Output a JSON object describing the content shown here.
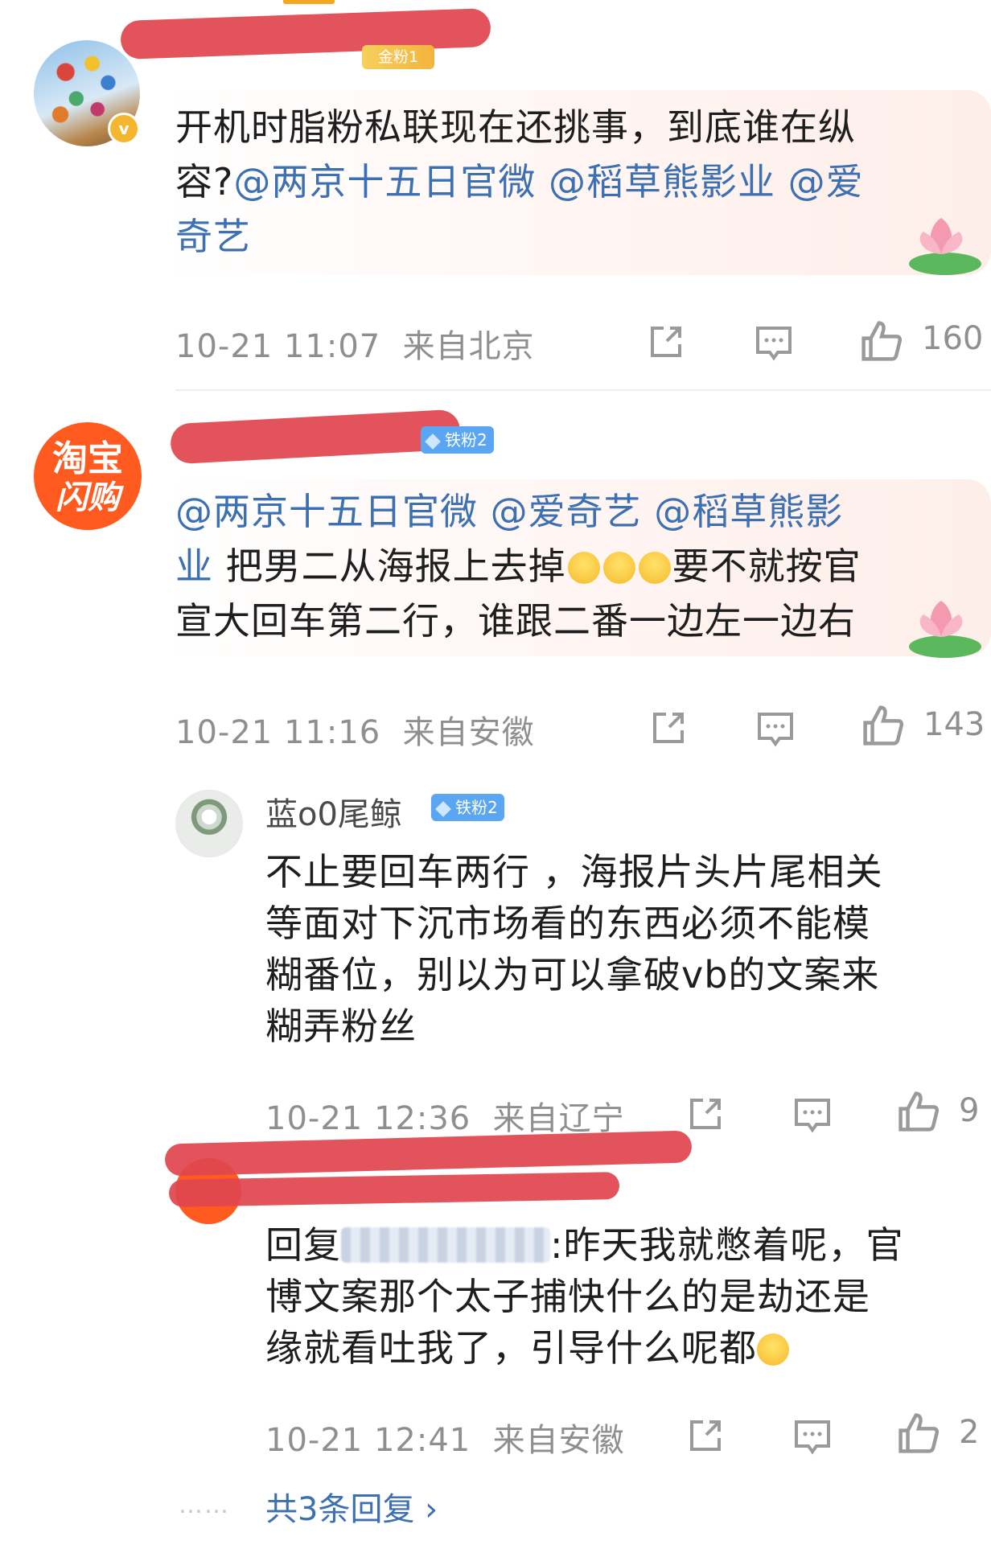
{
  "comments": [
    {
      "badge": "金粉1",
      "text_plain_1": "开机时脂粉私联现在还挑事，到底谁在纵",
      "text_plain_2": "容?",
      "mentions": [
        "@两京十五日官微",
        "@稻草熊影业",
        "@爱",
        "奇艺"
      ],
      "time": "10-21 11:07",
      "location": "来自北京",
      "likes": "160"
    },
    {
      "avatar_line1": "淘宝",
      "avatar_line2": "闪购",
      "badge": "铁粉2",
      "mentions": [
        "@两京十五日官微",
        "@爱奇艺",
        "@稻草熊影",
        "业"
      ],
      "text_1": "把男二从海报上去掉",
      "text_2": "要不就按官",
      "text_3": "宣大回车第二行，谁跟二番一边左一边右",
      "time": "10-21 11:16",
      "location": "来自安徽",
      "likes": "143"
    }
  ],
  "replies": [
    {
      "username": "蓝o0尾鲸",
      "badge": "铁粉2",
      "lines": [
        "不止要回车两行 ，海报片头片尾相关",
        "等面对下沉市场看的东西必须不能模",
        "糊番位，别以为可以拿破vb的文案来",
        "糊弄粉丝"
      ],
      "time": "10-21 12:36",
      "location": "来自辽宁",
      "likes": "9"
    },
    {
      "reply_prefix": "回复",
      "reply_tail": ":昨天我就憋着呢，官",
      "lines": [
        "博文案那个太子捕快什么的是劫还是",
        "缘就看吐我了，引导什么呢都"
      ],
      "time": "10-21 12:41",
      "location": "来自安徽",
      "likes": "2"
    }
  ],
  "more_replies": "共3条回复 ›",
  "dots": "……",
  "icons": [
    "share-icon",
    "comment-icon",
    "like-icon"
  ],
  "colors": {
    "link": "#3d6fb3",
    "meta": "#8f8f8f",
    "redaction": "#e0464f",
    "orange": "#ff5a1f"
  }
}
